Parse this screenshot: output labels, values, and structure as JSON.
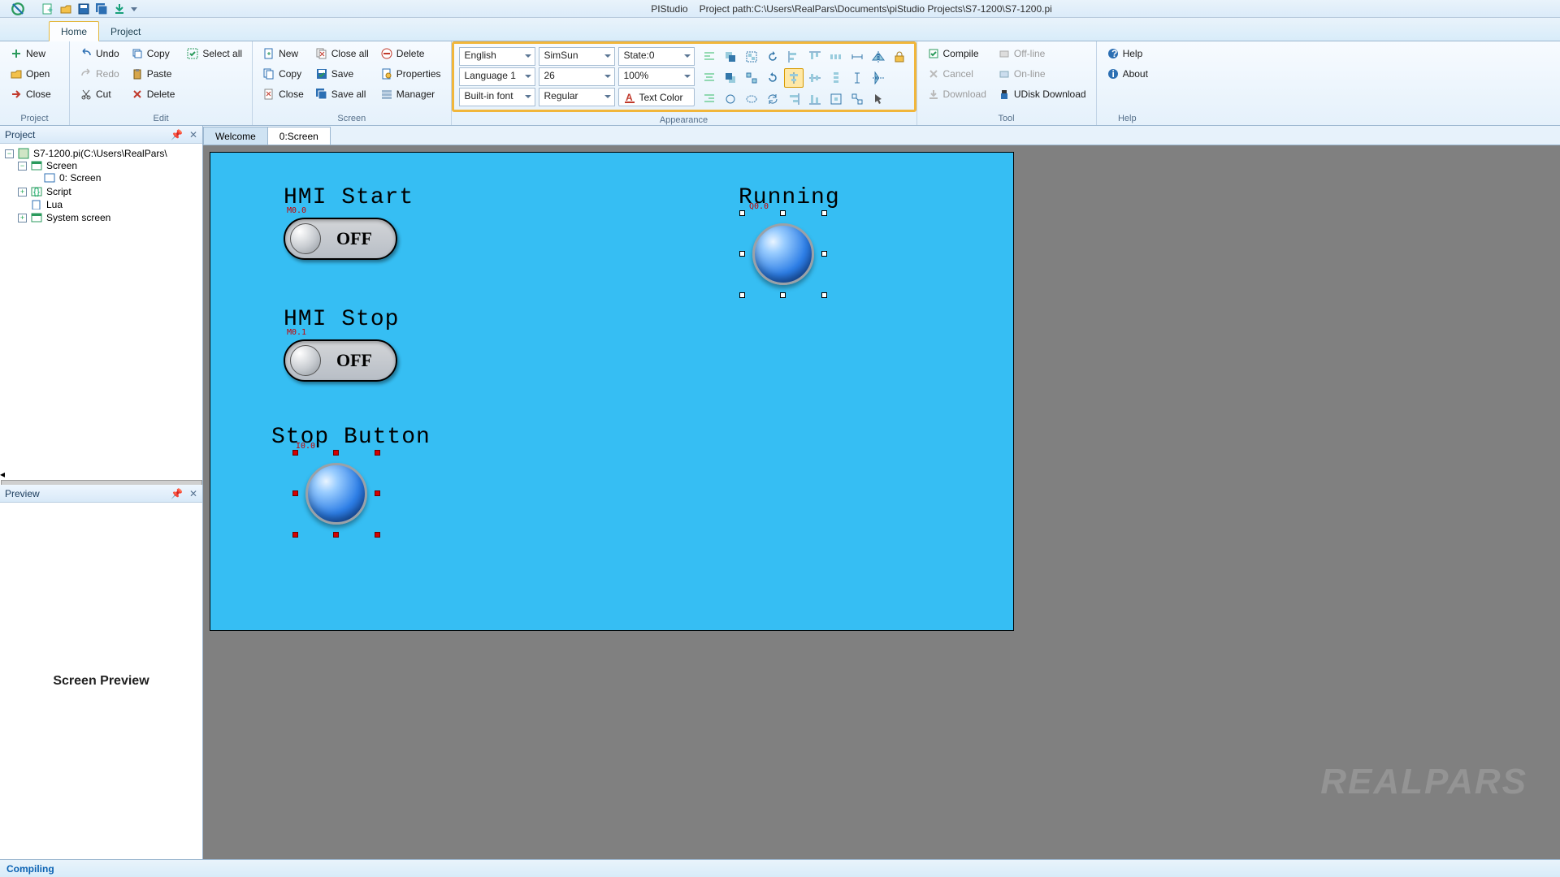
{
  "title": {
    "app": "PIStudio",
    "path_label": "Project path:",
    "path": "C:\\Users\\RealPars\\Documents\\piStudio Projects\\S7-1200\\S7-1200.pi"
  },
  "tabs": {
    "home": "Home",
    "project": "Project"
  },
  "ribbon": {
    "project": {
      "label": "Project",
      "new": "New",
      "open": "Open",
      "close": "Close"
    },
    "edit": {
      "label": "Edit",
      "undo": "Undo",
      "redo": "Redo",
      "copy": "Copy",
      "paste": "Paste",
      "cut": "Cut",
      "selectall": "Select all",
      "delete": "Delete"
    },
    "screen": {
      "label": "Screen",
      "new": "New",
      "copy": "Copy",
      "close": "Close",
      "closeall": "Close all",
      "save": "Save",
      "saveall": "Save all",
      "delete": "Delete",
      "properties": "Properties",
      "manager": "Manager"
    },
    "appearance": {
      "label": "Appearance",
      "language": "English",
      "font": "SimSun",
      "state": "State:0",
      "langslot": "Language 1",
      "size": "26",
      "zoom": "100%",
      "fontmode": "Built-in font",
      "weight": "Regular",
      "textcolor": "Text Color"
    },
    "tool": {
      "label": "Tool",
      "compile": "Compile",
      "cancel": "Cancel",
      "download": "Download",
      "offline": "Off-line",
      "online": "On-line",
      "udisk": "UDisk Download"
    },
    "help": {
      "label": "Help",
      "help": "Help",
      "about": "About"
    }
  },
  "panes": {
    "project": "Project",
    "preview": "Preview",
    "preview_body": "Screen Preview"
  },
  "tree": {
    "root": "S7-1200.pi(C:\\Users\\RealPars\\",
    "screen": "Screen",
    "screen0": "0: Screen",
    "script": "Script",
    "lua": "Lua",
    "system": "System screen"
  },
  "docs": {
    "welcome": "Welcome",
    "screen0": "0:Screen"
  },
  "hmi": {
    "start": "HMI Start",
    "stop": "HMI Stop",
    "stopbtn": "Stop Button",
    "running": "Running",
    "off": "OFF",
    "tags": {
      "start": "M0.0",
      "stop": "M0.1",
      "stopbtn": "I0.0",
      "running": "Q0.0"
    }
  },
  "status": "Compiling",
  "watermark": "REALPARS"
}
